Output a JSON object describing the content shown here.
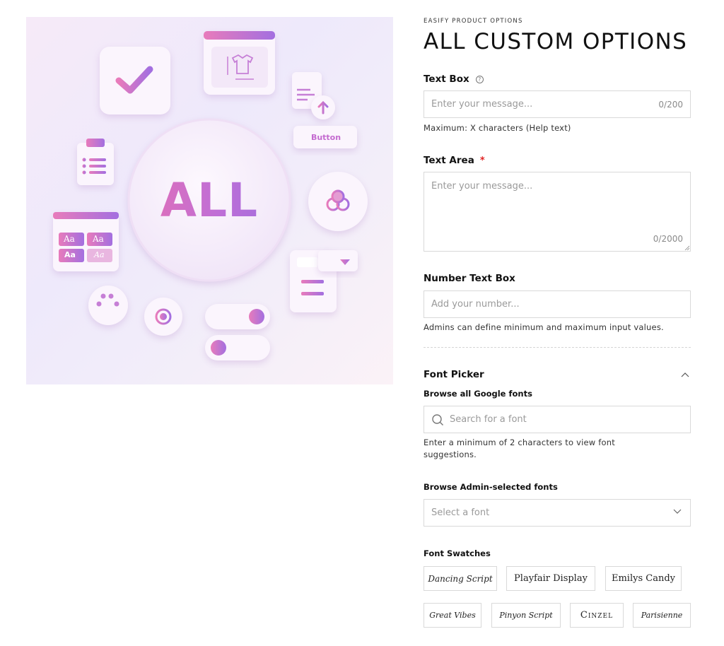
{
  "hero": {
    "center_text": "ALL",
    "button_label": "Button",
    "tiles": [
      "Aa",
      "Aa",
      "Aa",
      "Aa"
    ]
  },
  "header": {
    "eyebrow": "EASIFY PRODUCT OPTIONS",
    "title": "ALL CUSTOM OPTIONS"
  },
  "text_box": {
    "label": "Text Box",
    "help_icon": "?",
    "placeholder": "Enter your message...",
    "counter": "0/200",
    "help": "Maximum: X characters (Help text)"
  },
  "text_area": {
    "label": "Text Area",
    "required_mark": "*",
    "placeholder": "Enter your message...",
    "counter": "0/2000"
  },
  "number_box": {
    "label": "Number Text Box",
    "placeholder": "Add your number...",
    "help": "Admins can define minimum and maximum input values."
  },
  "font_picker": {
    "label": "Font Picker",
    "google_label": "Browse all Google fonts",
    "search_placeholder": "Search for a font",
    "google_help": "Enter a minimum of 2 characters to view font suggestions.",
    "admin_label": "Browse Admin-selected fonts",
    "select_placeholder": "Select a font",
    "swatches_label": "Font Swatches",
    "swatches": [
      "Dancing Script",
      "Playfair Display",
      "Emilys Candy",
      "Great Vibes",
      "Pinyon Script",
      "Cinzel",
      "Parisienne"
    ]
  },
  "colors": {
    "accent_pink": "#e76fb2",
    "accent_purple": "#9b6ce0",
    "required": "#e02424",
    "border": "#d9d9d9"
  }
}
